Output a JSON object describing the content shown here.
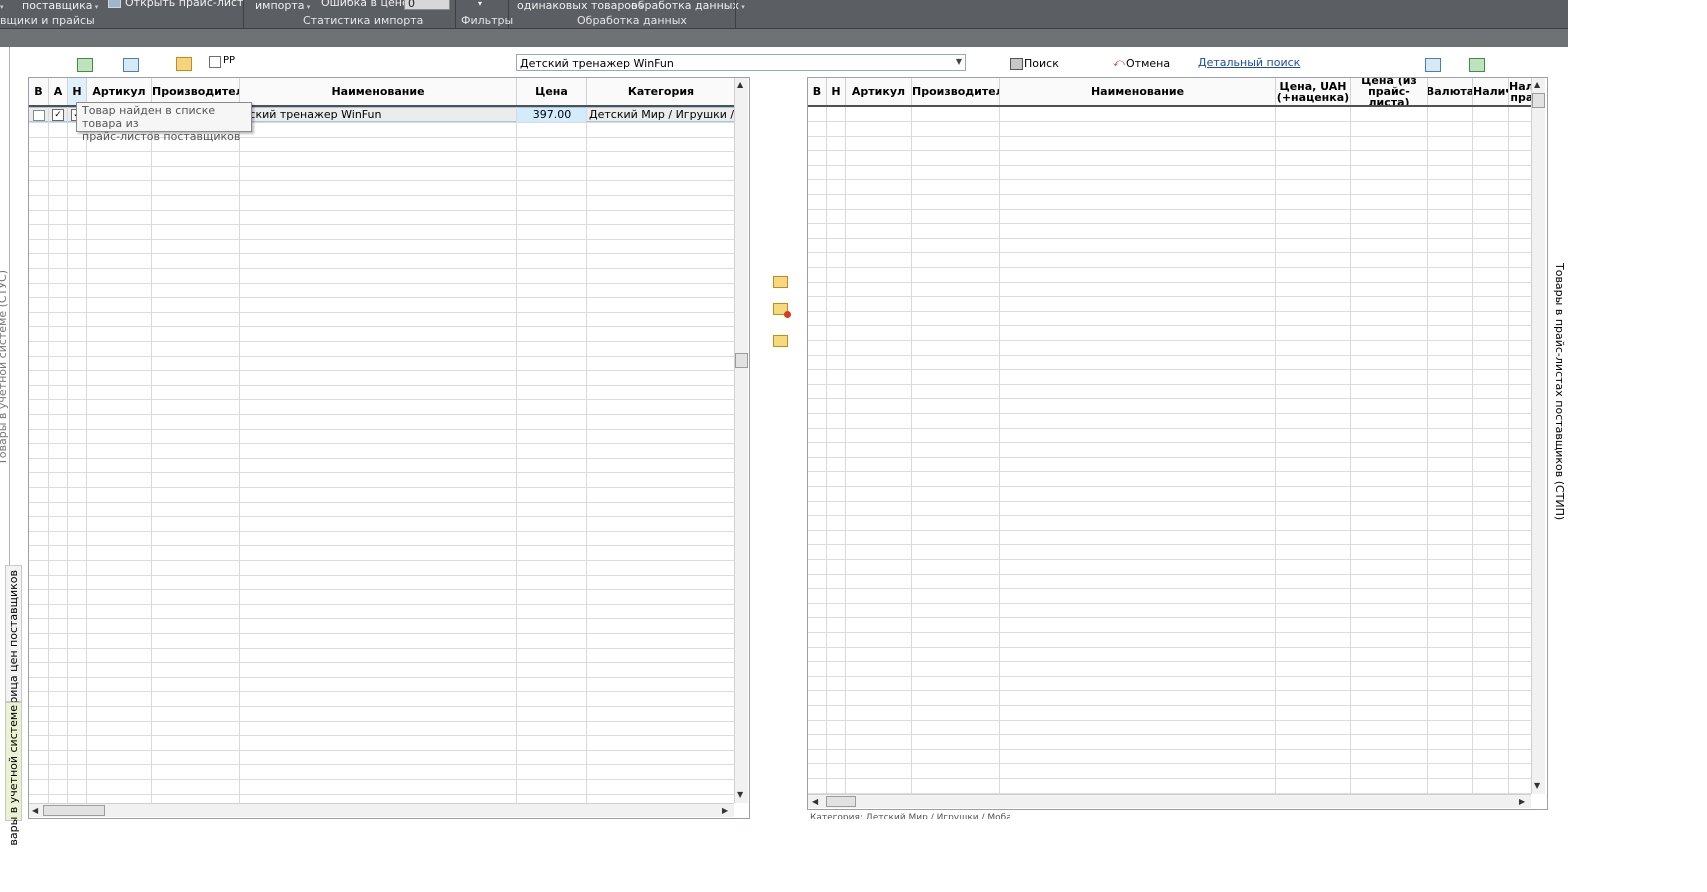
{
  "ribbon": {
    "items": [
      "поставщика",
      "Открыть прайс-лист",
      "импорта",
      "Ошибка в цене",
      "одинаковых товаров",
      "обработка данных"
    ],
    "price_error_value": "0",
    "groups": [
      "вщики и прайсы",
      "Статистика импорта",
      "Фильтры",
      "Обработка данных"
    ]
  },
  "left_tabs": {
    "accounting_system_cut": "Товары в учетной системе (СТУС)",
    "price_matrix": "Матрица цен поставщиков",
    "accounting_system": "вары в учетной системе"
  },
  "right_tab": "Товары в прайс-листах поставщиков (СТИП)",
  "toolbar": {
    "pp_label": "PP",
    "search_value": "Детский тренажер WinFun",
    "search_button": "Поиск",
    "cancel_button": "Отмена",
    "detailed_search_link": "Детальный поиск"
  },
  "left_grid": {
    "columns": [
      "В",
      "А",
      "Н",
      "Артикул",
      "Производитель",
      "Наименование",
      "Цена",
      "Категория"
    ],
    "rows": [
      {
        "name": "тский тренажер WinFun",
        "price": "397.00",
        "category": "Детский Мир / Игрушки / Разв"
      }
    ]
  },
  "tooltip": {
    "line1": "Товар найден в списке товара из",
    "line2": "прайс-листов поставщиков"
  },
  "right_grid": {
    "columns": [
      "В",
      "Н",
      "Артикул",
      "Производитель",
      "Наименование",
      "Цена, UAH (+наценка)",
      "Цена (из прайс-листа)",
      "Валюта",
      "Наличи",
      "Налич прайс"
    ]
  },
  "status_text": "Категория: Детский Мир / Игрушки / Мобайл"
}
